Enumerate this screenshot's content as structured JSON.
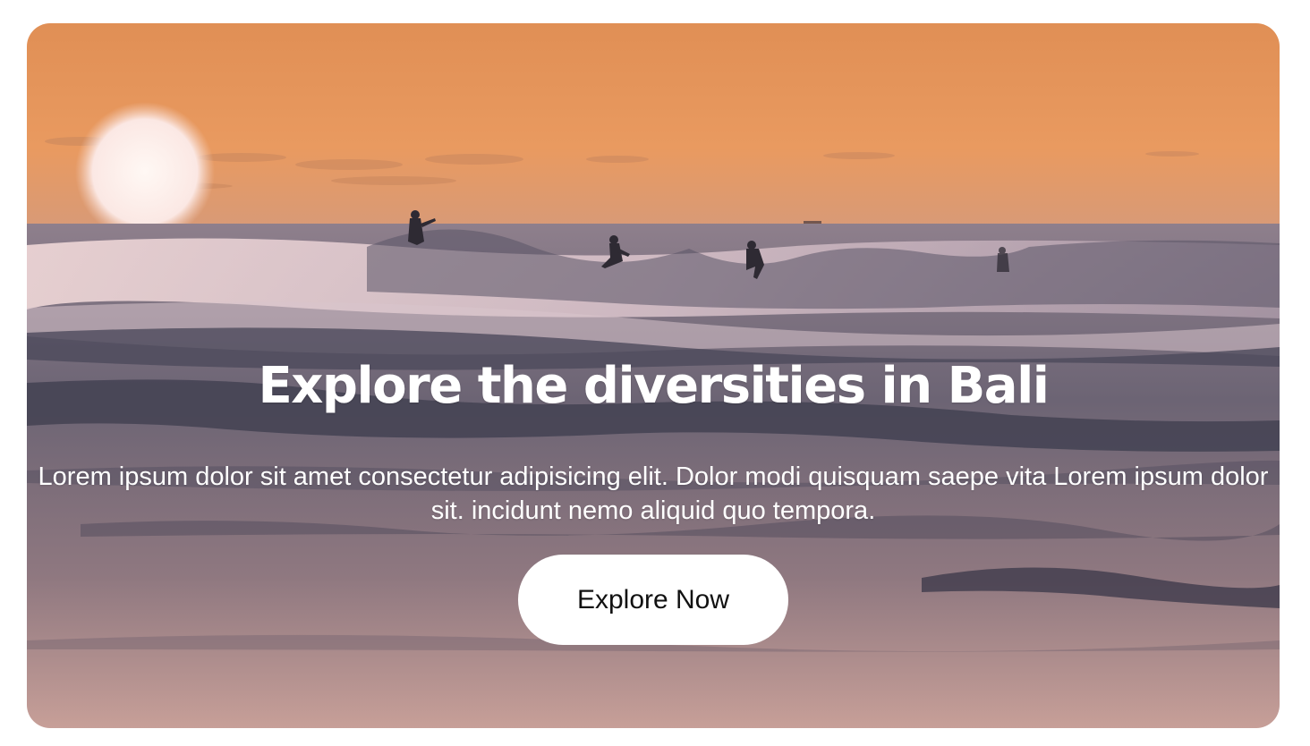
{
  "hero": {
    "title": "Explore the diversities in Bali",
    "description": "Lorem ipsum dolor sit amet consectetur adipisicing elit. Dolor modi quisquam saepe vita Lorem ipsum dolor sit. incidunt nemo aliquid quo tempora.",
    "button_label": "Explore Now"
  },
  "colors": {
    "sky": "#e8955a",
    "sea": "#6e6676",
    "button_bg": "#ffffff",
    "text": "#ffffff"
  }
}
